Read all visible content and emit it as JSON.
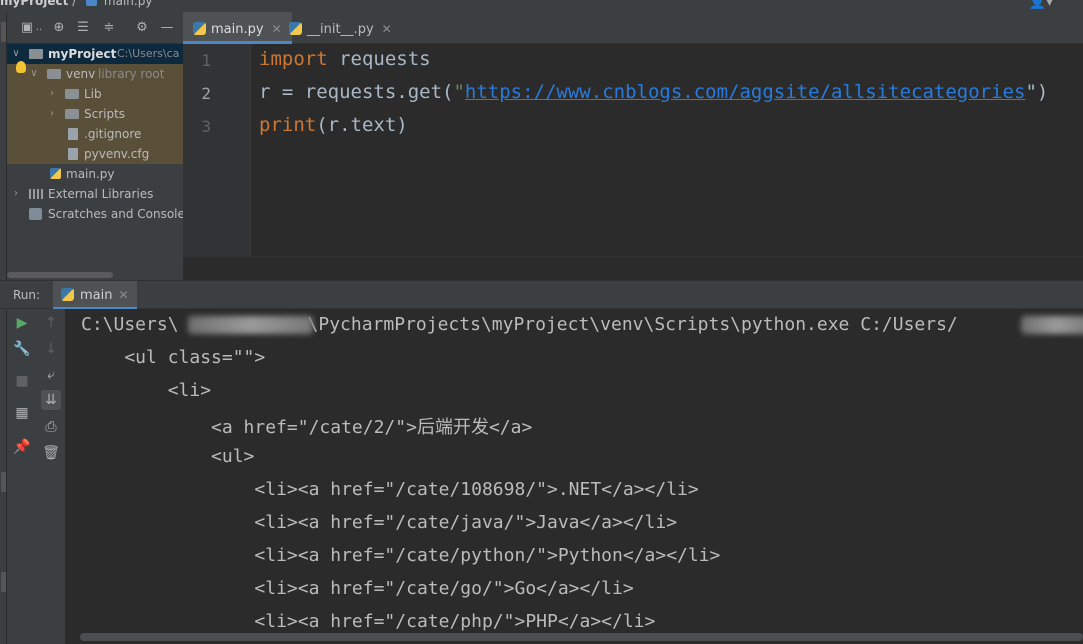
{
  "window": {
    "project_title": "myProject",
    "file_title": "main.py"
  },
  "editor_tabs": [
    {
      "label": "main.py",
      "active": true
    },
    {
      "label": "__init__.py",
      "active": false
    }
  ],
  "project_tree": {
    "root": {
      "label": "myProject",
      "path": "C:\\Users\\ca"
    },
    "venv": {
      "label": "venv",
      "note": "library root"
    },
    "lib": "Lib",
    "scripts": "Scripts",
    "gitignore": ".gitignore",
    "pyvenv": "pyvenv.cfg",
    "main": "main.py",
    "external": "External Libraries",
    "scratches": "Scratches and Consoles"
  },
  "editor": {
    "line_numbers": [
      "1",
      "2",
      "3"
    ],
    "line1": {
      "keyword": "import",
      "rest": " requests"
    },
    "line2": {
      "prefix": "r = requests.get(",
      "quote_open": "\"",
      "url": "https://www.cnblogs.com/aggsite/allsitecategories",
      "suffix": "\")"
    },
    "line3": {
      "func": "print",
      "rest": "(r.text)"
    }
  },
  "run_panel": {
    "label": "Run:",
    "tab": "main"
  },
  "console": {
    "line0_a": "C:\\Users\\",
    "line0_b": "\\PycharmProjects\\myProject\\venv\\Scripts\\python.exe C:/Users/",
    "lines": [
      "    <ul class=\"\">",
      "        <li>",
      "            <a href=\"/cate/2/\">后端开发</a>",
      "            <ul>",
      "                <li><a href=\"/cate/108698/\">.NET</a></li>",
      "                <li><a href=\"/cate/java/\">Java</a></li>",
      "                <li><a href=\"/cate/python/\">Python</a></li>",
      "                <li><a href=\"/cate/go/\">Go</a></li>",
      "                <li><a href=\"/cate/php/\">PHP</a></li>"
    ]
  },
  "colors": {
    "keyword": "#cc7832",
    "string": "#6a8759",
    "url": "#287bde",
    "accent": "#4a88c7",
    "run_green": "#59a869"
  }
}
